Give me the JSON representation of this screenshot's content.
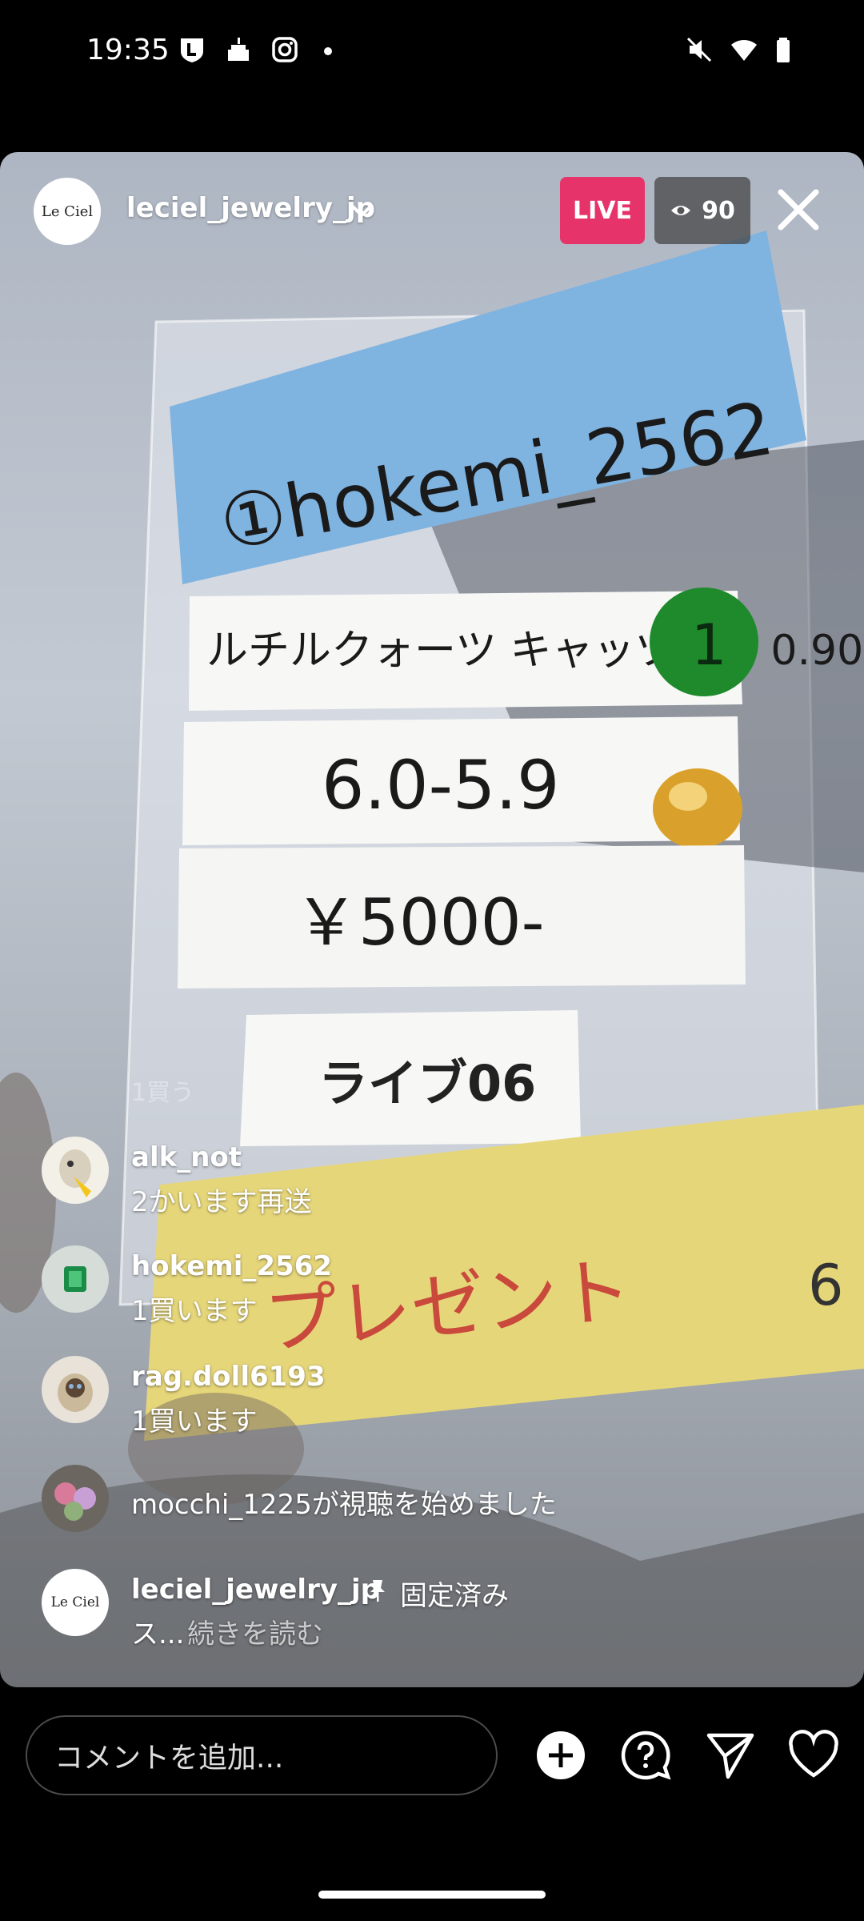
{
  "status": {
    "time": "19:35"
  },
  "header": {
    "avatar_text": "Le Ciel",
    "username": "leciel_jewelry_jp",
    "live_label": "LIVE",
    "viewer_count": "90"
  },
  "video": {
    "note_user": "①hokemi_2562",
    "note_item": "ルチルクォーツ キャッツアイ 0.90",
    "note_size": "6.0-5.9",
    "note_price": "￥5000-",
    "note_badge": "1",
    "note_live": "ライブ06",
    "note_present": "プレゼント",
    "note_present_num": "6"
  },
  "comments": {
    "faded_text": "1買う",
    "items": [
      {
        "name": "alk_not",
        "text": "2かいます再送"
      },
      {
        "name": "hokemi_2562",
        "text": "1買います"
      },
      {
        "name": "rag.doll6193",
        "text": "1買います"
      },
      {
        "text": "mocchi_1225が視聴を始めました"
      },
      {
        "name": "leciel_jewelry_jp",
        "pinned": "固定済み",
        "text_prefix": "ス...",
        "read_more": "続きを読む",
        "avatar_text": "Le Ciel"
      }
    ]
  },
  "bottom": {
    "comment_placeholder": "コメントを追加..."
  }
}
